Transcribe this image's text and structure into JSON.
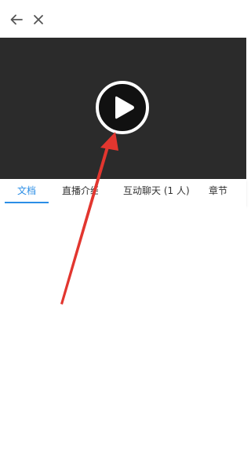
{
  "header": {
    "back_icon": "arrow-left-icon",
    "close_icon": "close-icon"
  },
  "player": {
    "play_icon": "play-circle-icon",
    "background": "#2b2b2b"
  },
  "tabs": [
    {
      "label": "文档",
      "active": true
    },
    {
      "label": "直播介绍",
      "active": false
    },
    {
      "label": "互动聊天 (1 人)",
      "active": false
    },
    {
      "label": "章节",
      "active": false
    }
  ],
  "colors": {
    "accent": "#2b8ee6",
    "annotation_arrow": "#e2362f"
  }
}
